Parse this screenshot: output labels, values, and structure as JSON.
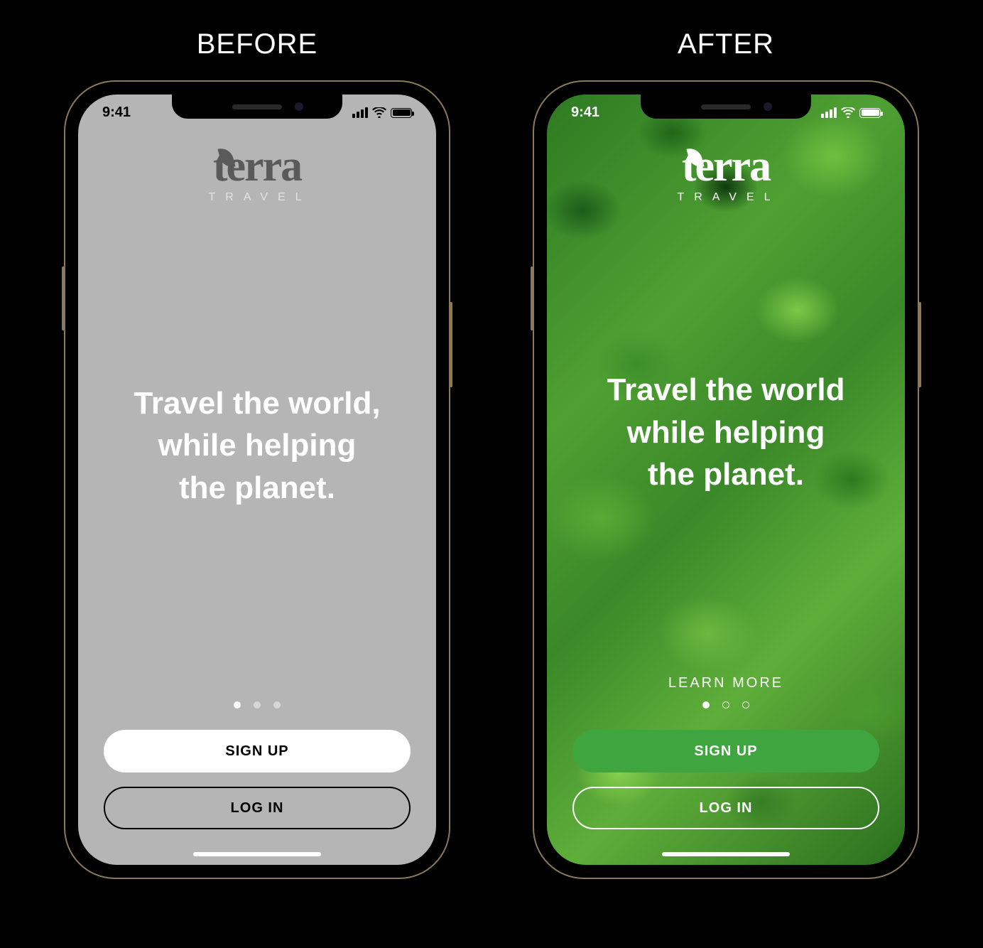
{
  "labels": {
    "before": "BEFORE",
    "after": "AFTER"
  },
  "status": {
    "time": "9:41"
  },
  "brand": {
    "name": "terra",
    "tagline": "TRAVEL"
  },
  "before": {
    "hero_line1": "Travel the world,",
    "hero_line2": "while helping",
    "hero_line3": "the planet.",
    "buttons": {
      "signup": "SIGN UP",
      "login": "LOG IN"
    },
    "pager": {
      "count": 3,
      "active": 0
    }
  },
  "after": {
    "hero_line1": "Travel the world",
    "hero_line2": "while helping",
    "hero_line3": "the planet.",
    "learn_more": "LEARN MORE",
    "buttons": {
      "signup": "SIGN UP",
      "login": "LOG IN"
    },
    "pager": {
      "count": 3,
      "active": 0
    }
  },
  "colors": {
    "after_primary_button": "#3fa63f",
    "before_bg": "#b5b5b5"
  }
}
